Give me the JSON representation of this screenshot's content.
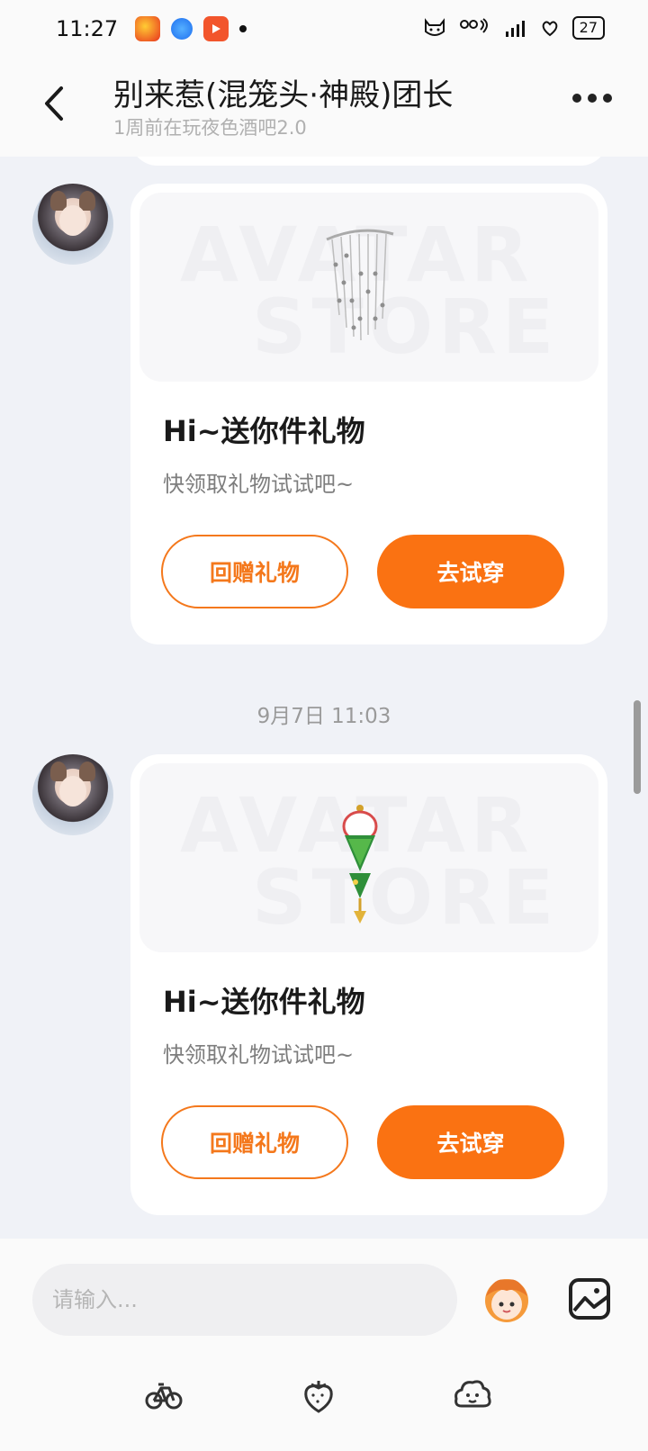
{
  "status_bar": {
    "time": "11:27",
    "battery": "27"
  },
  "header": {
    "title": "别来惹(混笼头·神殿)团长",
    "subtitle": "1周前在玩夜色酒吧2.0"
  },
  "messages": [
    {
      "card_title": "Hi~送你件礼物",
      "card_desc": "快领取礼物试试吧~",
      "btn_gift_back": "回赠礼物",
      "btn_try_on": "去试穿",
      "watermark_line1": "AVATAR",
      "watermark_line2": "STORE",
      "gift_icon": "crystal-curtain-icon"
    },
    {
      "timestamp": "9月7日 11:03",
      "card_title": "Hi~送你件礼物",
      "card_desc": "快领取礼物试试吧~",
      "btn_gift_back": "回赠礼物",
      "btn_try_on": "去试穿",
      "watermark_line1": "AVATAR",
      "watermark_line2": "STORE",
      "gift_icon": "zongzi-charm-icon"
    }
  ],
  "input": {
    "placeholder": "请输入..."
  },
  "colors": {
    "accent": "#fa7212",
    "background": "#f0f2f7"
  }
}
